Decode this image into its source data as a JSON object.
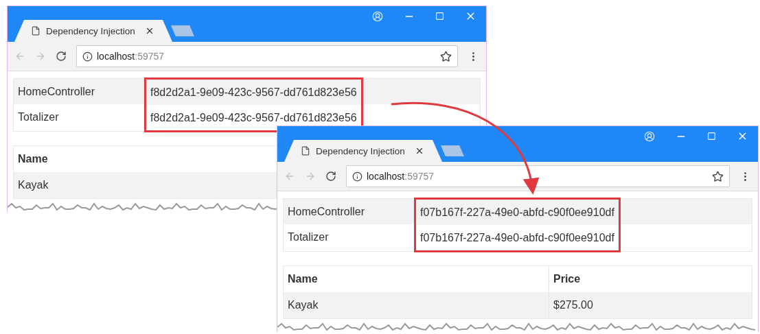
{
  "windows": [
    {
      "tab_title": "Dependency Injection",
      "url_host": "localhost",
      "url_port": ":59757",
      "ids": {
        "highlighted": true,
        "rows": [
          {
            "label": "HomeController",
            "value": "f8d2d2a1-9e09-423c-9567-dd761d823e56"
          },
          {
            "label": "Totalizer",
            "value": "f8d2d2a1-9e09-423c-9567-dd761d823e56"
          }
        ]
      },
      "products": {
        "columns": [
          "Name"
        ],
        "rows": [
          [
            "Kayak"
          ]
        ]
      }
    },
    {
      "tab_title": "Dependency Injection",
      "url_host": "localhost",
      "url_port": ":59757",
      "ids": {
        "highlighted": true,
        "rows": [
          {
            "label": "HomeController",
            "value": "f07b167f-227a-49e0-abfd-c90f0ee910df"
          },
          {
            "label": "Totalizer",
            "value": "f07b167f-227a-49e0-abfd-c90f0ee910df"
          }
        ]
      },
      "products": {
        "columns": [
          "Name",
          "Price"
        ],
        "rows": [
          [
            "Kayak",
            "$275.00"
          ]
        ]
      }
    }
  ]
}
